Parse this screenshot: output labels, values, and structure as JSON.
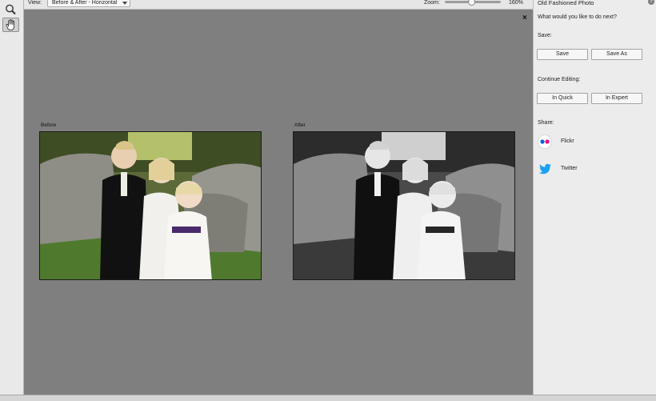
{
  "options_bar": {
    "view_label": "View:",
    "view_value": "Before & After - Horizontal",
    "zoom_label": "Zoom:",
    "zoom_value": "160%"
  },
  "tools": [
    {
      "name": "zoom-tool",
      "icon": "magnifier-icon"
    },
    {
      "name": "hand-tool",
      "icon": "hand-icon",
      "selected": true
    }
  ],
  "canvas": {
    "before_label": "Before",
    "after_label": "After",
    "close_glyph": "×"
  },
  "panel": {
    "title": "Old Fashioned Photo",
    "help_glyph": "?",
    "prompt": "What would you like to do next?",
    "save_heading": "Save:",
    "save_button": "Save",
    "save_as_button": "Save As",
    "continue_heading": "Continue Editing:",
    "quick_button": "In Quick",
    "expert_button": "In Expert",
    "share_heading": "Share:",
    "share_items": [
      {
        "label": "Flickr",
        "icon": "flickr-icon"
      },
      {
        "label": "Twitter",
        "icon": "twitter-icon"
      }
    ]
  },
  "colors": {
    "flickr_blue": "#0063dc",
    "flickr_pink": "#ff0084",
    "twitter_blue": "#1da1f2"
  }
}
